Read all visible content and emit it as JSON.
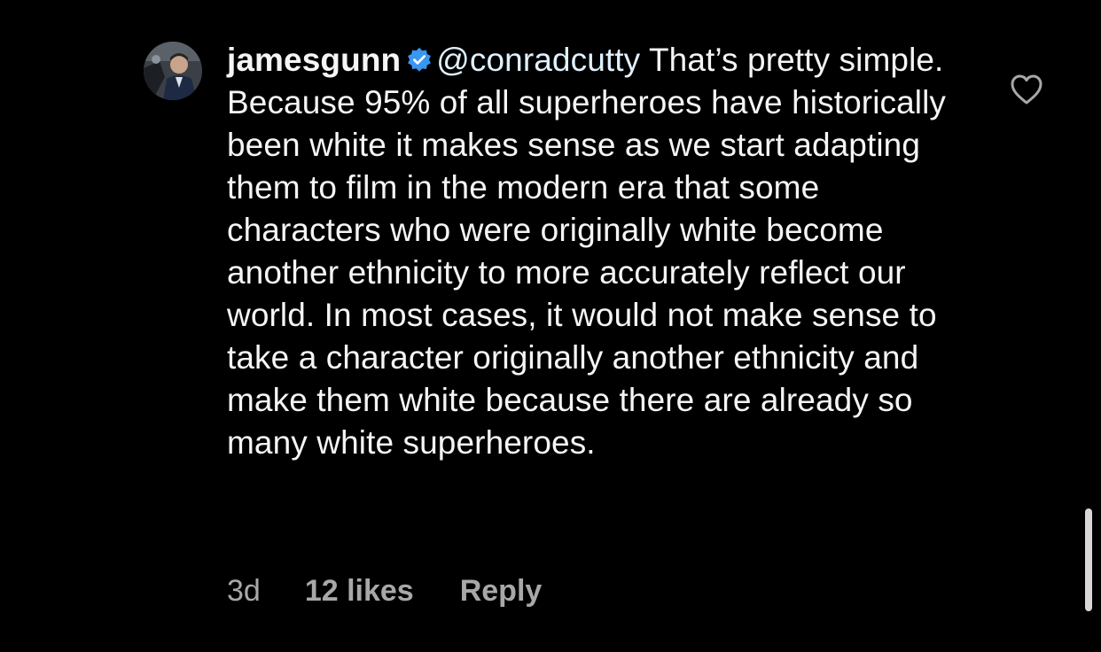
{
  "comment": {
    "username": "jamesgunn",
    "verified_icon": "verified-badge-icon",
    "mention": "@conradcutty",
    "text": " That’s pretty simple. Because 95% of all superheroes have historically been white it makes sense as we start adapting them to film in the modern era that some characters who were originally white become another ethnicity to more accurately reflect our world. In most cases, it would not make sense to take a character originally another ethnicity and make them white because there are already so many white superheroes.",
    "like_icon": "heart-icon"
  },
  "meta": {
    "time": "3d",
    "likes": "12 likes",
    "reply": "Reply"
  },
  "colors": {
    "background": "#000000",
    "text": "#f5f5f5",
    "meta_text": "#a8a8a8",
    "verified": "#3897f0"
  }
}
